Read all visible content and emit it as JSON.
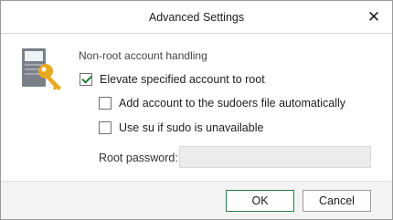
{
  "window": {
    "title": "Advanced Settings",
    "close_icon": "close-icon"
  },
  "section": {
    "title": "Non-root account handling",
    "icon": "server-key-icon"
  },
  "options": {
    "elevate": {
      "label": "Elevate specified account to root",
      "checked": true
    },
    "sudoers": {
      "label": "Add account to the sudoers file automatically",
      "checked": false
    },
    "use_su": {
      "label": "Use su if sudo is unavailable",
      "checked": false
    }
  },
  "root_password": {
    "label": "Root password:",
    "value": "",
    "enabled": false
  },
  "buttons": {
    "ok": "OK",
    "cancel": "Cancel"
  },
  "colors": {
    "accent": "#2d7d49",
    "checkmark": "#1f7a35",
    "footer_bg": "#f3f3f3",
    "disabled_input": "#ececec",
    "key_gold": "#e8a81f"
  }
}
